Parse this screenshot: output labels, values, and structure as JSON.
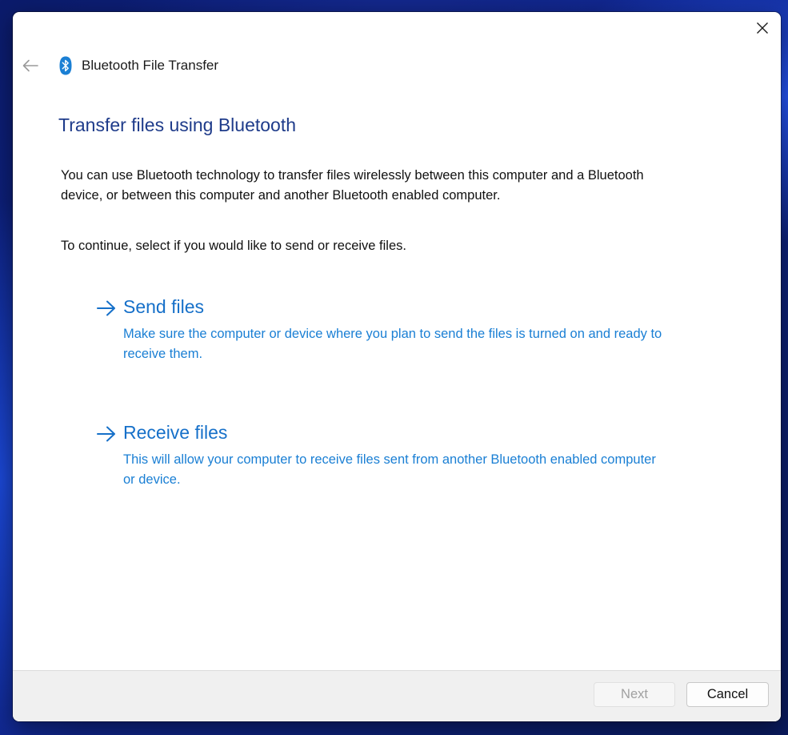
{
  "window": {
    "title": "Bluetooth File Transfer"
  },
  "content": {
    "heading": "Transfer files using Bluetooth",
    "intro": "You can use Bluetooth technology to transfer files wirelessly between this computer and a Bluetooth device, or between this computer and another Bluetooth enabled computer.",
    "prompt": "To continue, select if you would like to send or receive files."
  },
  "options": {
    "send": {
      "title": "Send files",
      "description": "Make sure the computer or device where you plan to send the files is turned on and ready to receive them."
    },
    "receive": {
      "title": "Receive files",
      "description": "This will allow your computer to receive files sent from another Bluetooth enabled computer or device."
    }
  },
  "footer": {
    "next_label": "Next",
    "next_enabled": false,
    "cancel_label": "Cancel"
  },
  "icons": {
    "close": "close-icon",
    "back": "back-arrow-icon",
    "bluetooth": "bluetooth-icon",
    "option_arrow": "arrow-right-icon"
  },
  "colors": {
    "heading": "#1e3b8a",
    "link_title": "#1670c9",
    "link_description": "#1a7fd4",
    "bluetooth_brand": "#1a7fd4",
    "footer_bg": "#f0f0f0"
  }
}
